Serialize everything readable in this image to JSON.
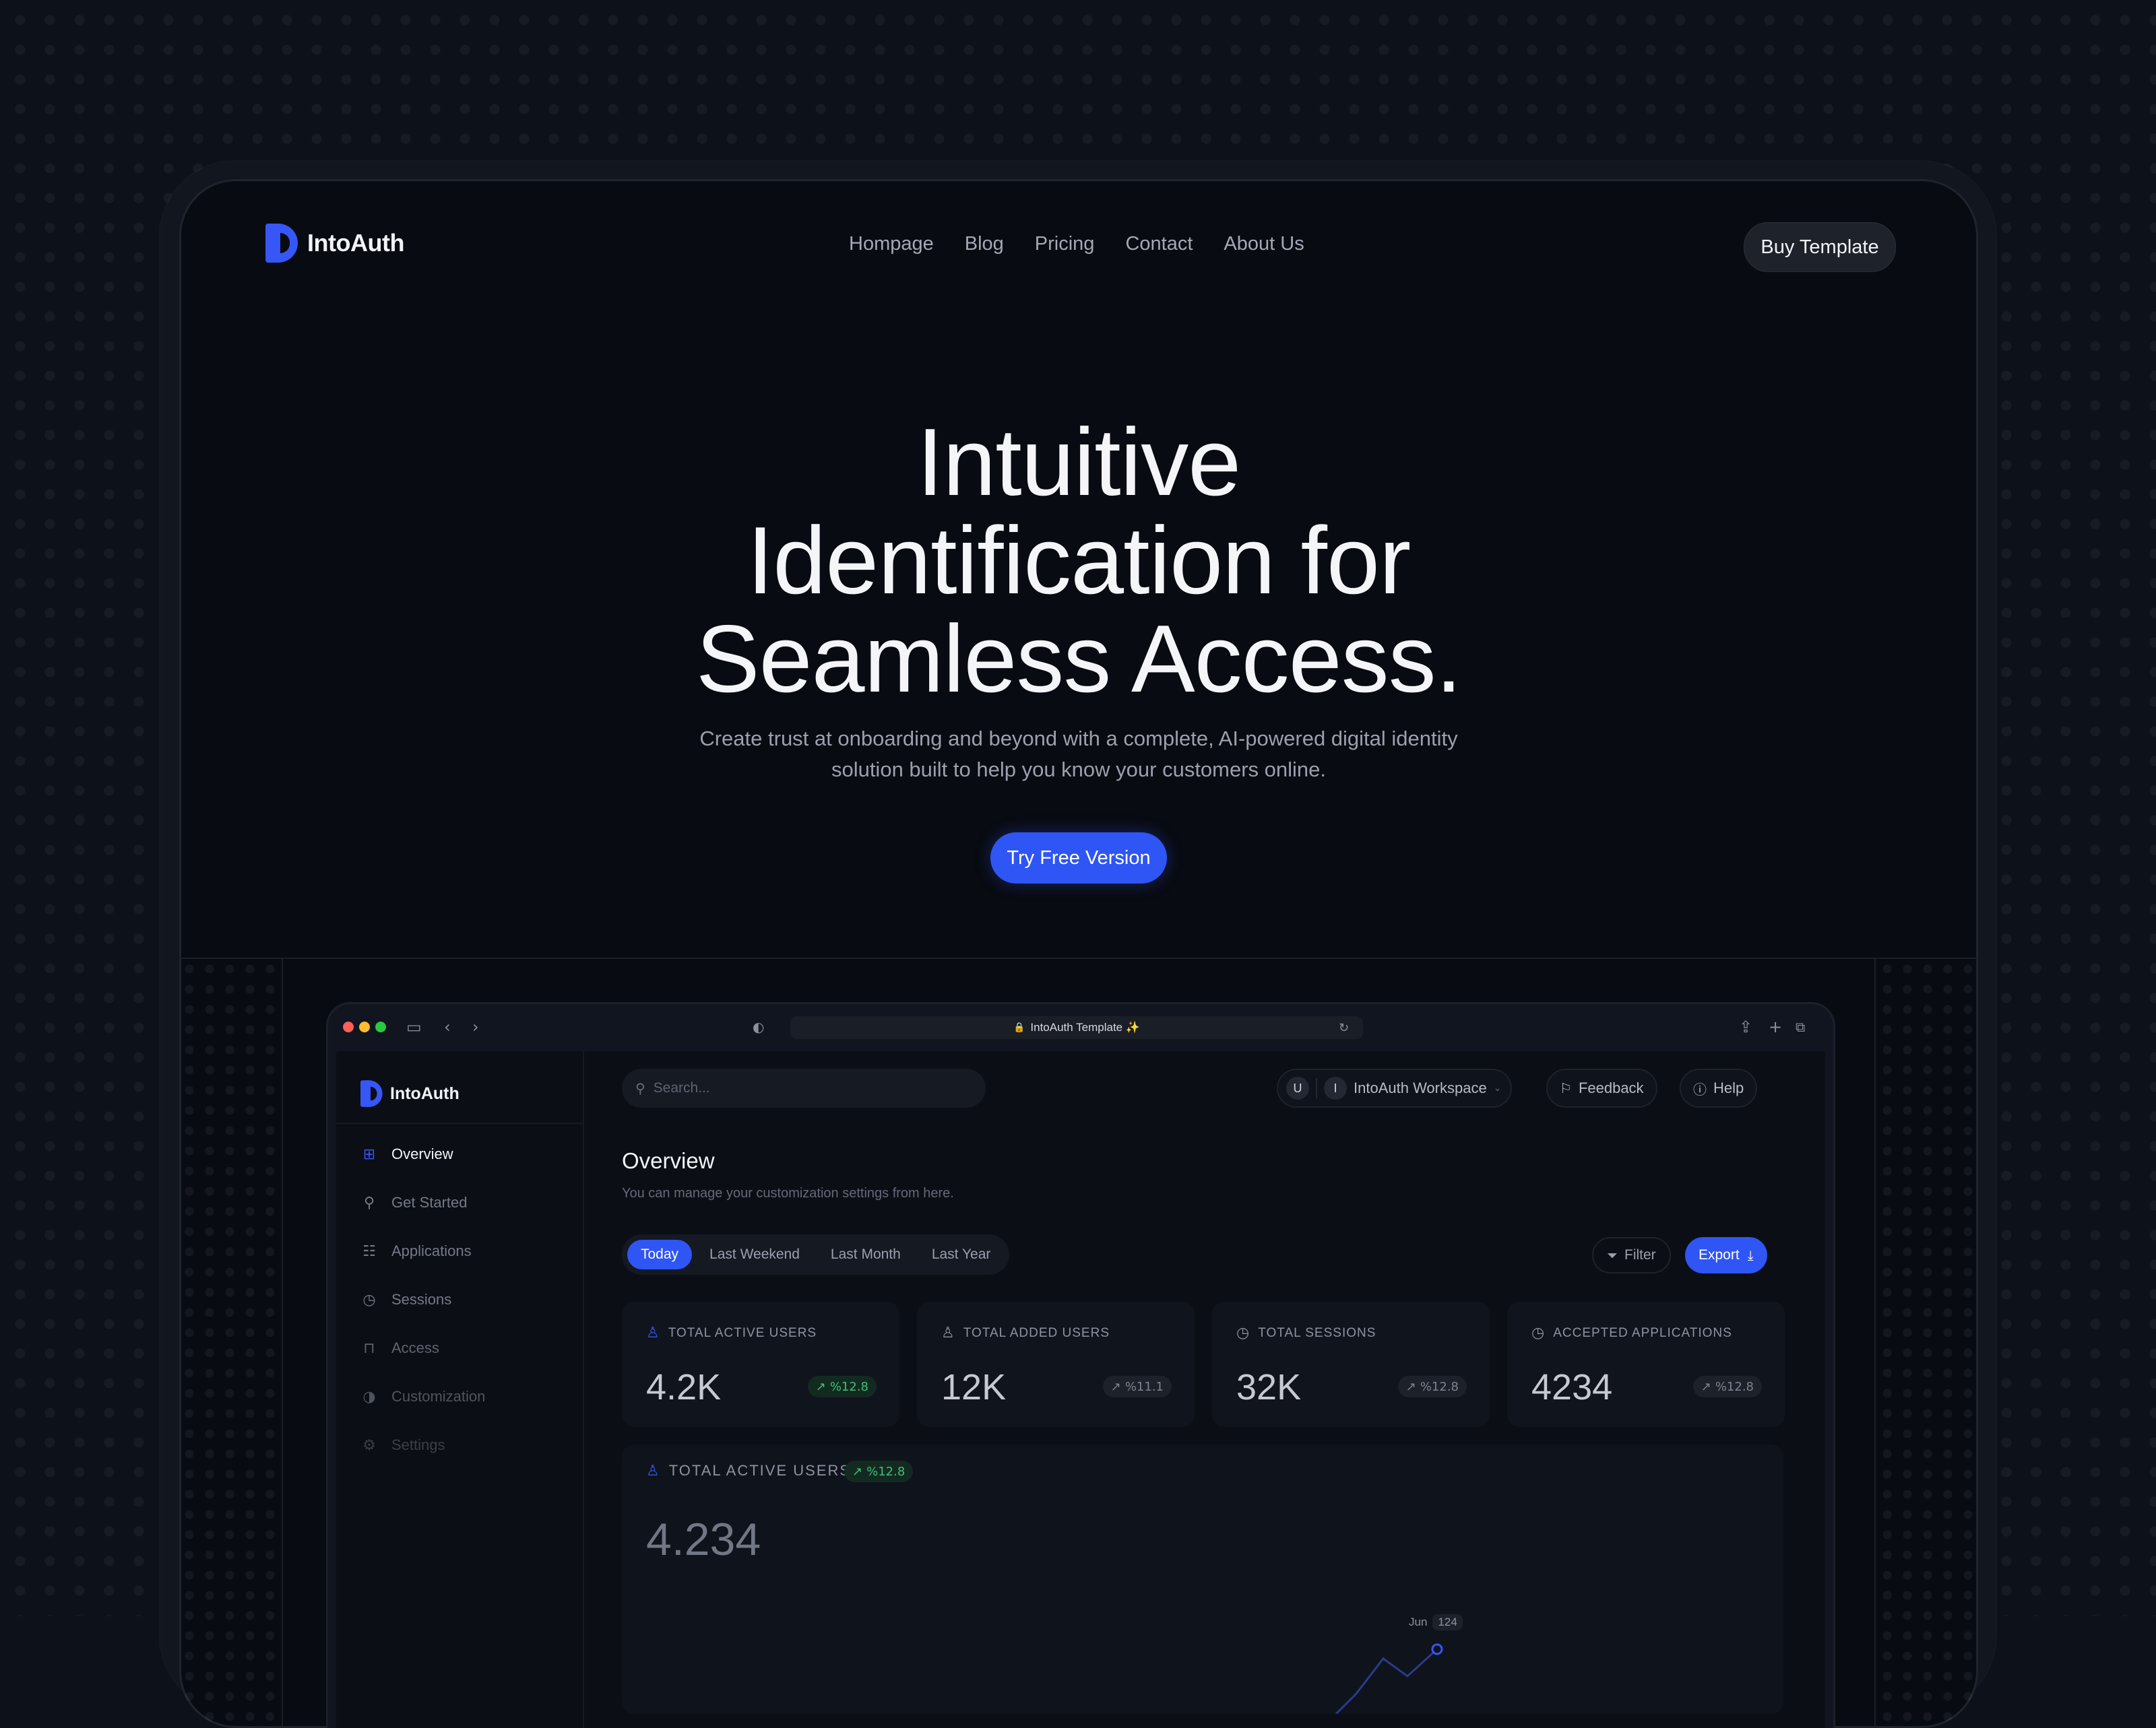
{
  "brand": {
    "name": "IntoAuth"
  },
  "nav": {
    "items": [
      "Hompage",
      "Blog",
      "Pricing",
      "Contact",
      "About Us"
    ],
    "buy_label": "Buy Template"
  },
  "hero": {
    "title_lines": [
      "Intuitive",
      "Identification for",
      "Seamless Access."
    ],
    "subtitle": "Create trust at onboarding and beyond with a complete, AI-powered digital identity solution built to help you know your customers online.",
    "cta_label": "Try Free Version"
  },
  "browser": {
    "url_text": "IntoAuth Template ✨"
  },
  "app": {
    "brand": "IntoAuth",
    "sidebar": {
      "items": [
        {
          "label": "Overview",
          "icon": "grid-icon",
          "active": true
        },
        {
          "label": "Get Started",
          "icon": "bulb-icon",
          "active": false
        },
        {
          "label": "Applications",
          "icon": "apps-icon",
          "active": false
        },
        {
          "label": "Sessions",
          "icon": "timer-icon",
          "active": false
        },
        {
          "label": "Access",
          "icon": "lock-icon",
          "active": false
        },
        {
          "label": "Customization",
          "icon": "palette-icon",
          "active": false
        },
        {
          "label": "Settings",
          "icon": "gear-icon",
          "active": false
        }
      ]
    },
    "search_placeholder": "Search...",
    "workspace": {
      "user_initial": "U",
      "workspace_initial": "I",
      "label": "IntoAuth Workspace"
    },
    "feedback_label": "Feedback",
    "help_label": "Help",
    "page": {
      "title": "Overview",
      "subtitle": "You can manage your customization settings from here."
    },
    "ranges": [
      "Today",
      "Last Weekend",
      "Last Month",
      "Last Year"
    ],
    "active_range": "Today",
    "filter_label": "Filter",
    "export_label": "Export",
    "stats": [
      {
        "label": "TOTAL ACTIVE USERS",
        "value": "4.2K",
        "change": "%12.8",
        "tone": "green",
        "icon": "user-icon"
      },
      {
        "label": "TOTAL ADDED USERS",
        "value": "12K",
        "change": "%11.1",
        "tone": "gray",
        "icon": "user-add-icon"
      },
      {
        "label": "TOTAL SESSIONS",
        "value": "32K",
        "change": "%12.8",
        "tone": "gray",
        "icon": "timer-icon"
      },
      {
        "label": "ACCEPTED APPLICATIONS",
        "value": "4234",
        "change": "%12.8",
        "tone": "gray",
        "icon": "timer-icon"
      }
    ],
    "active_users_chart": {
      "label": "TOTAL ACTIVE USERS",
      "change": "%12.8",
      "value": "4.234",
      "tooltip": {
        "month": "Jun",
        "value": "124"
      }
    }
  },
  "colors": {
    "accent": "#2f55f4",
    "positive": "#3fbf7a",
    "background": "#090b12"
  }
}
